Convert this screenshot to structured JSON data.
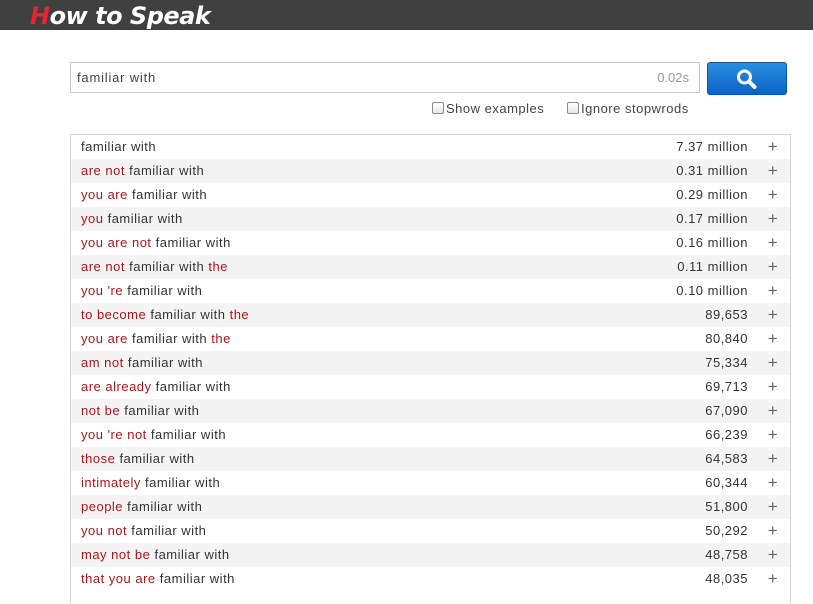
{
  "header": {
    "logo_first": "H",
    "logo_rest": "ow to Speak"
  },
  "search": {
    "value": "familiar with",
    "time": "0.02s",
    "button_icon": "search-icon"
  },
  "options": {
    "show_examples": "Show examples",
    "ignore_stopwords": "Ignore stopwrods"
  },
  "colors": {
    "topbar": "#404040",
    "logo_accent": "#e8242c",
    "extra_word": "#a8161c",
    "button": "#1a78d6"
  },
  "results": [
    {
      "words": [
        {
          "t": "familiar with",
          "q": true
        }
      ],
      "count": "7.37 million"
    },
    {
      "words": [
        {
          "t": "are not",
          "q": false
        },
        {
          "t": "familiar with",
          "q": true
        }
      ],
      "count": "0.31 million"
    },
    {
      "words": [
        {
          "t": "you are",
          "q": false
        },
        {
          "t": "familiar with",
          "q": true
        }
      ],
      "count": "0.29 million"
    },
    {
      "words": [
        {
          "t": "you",
          "q": false
        },
        {
          "t": "familiar with",
          "q": true
        }
      ],
      "count": "0.17 million"
    },
    {
      "words": [
        {
          "t": "you are not",
          "q": false
        },
        {
          "t": "familiar with",
          "q": true
        }
      ],
      "count": "0.16 million"
    },
    {
      "words": [
        {
          "t": "are not",
          "q": false
        },
        {
          "t": "familiar with",
          "q": true
        },
        {
          "t": "the",
          "q": false
        }
      ],
      "count": "0.11 million"
    },
    {
      "words": [
        {
          "t": "you 're",
          "q": false
        },
        {
          "t": "familiar with",
          "q": true
        }
      ],
      "count": "0.10 million"
    },
    {
      "words": [
        {
          "t": "to become",
          "q": false
        },
        {
          "t": "familiar with",
          "q": true
        },
        {
          "t": "the",
          "q": false
        }
      ],
      "count": "89,653"
    },
    {
      "words": [
        {
          "t": "you are",
          "q": false
        },
        {
          "t": "familiar with",
          "q": true
        },
        {
          "t": "the",
          "q": false
        }
      ],
      "count": "80,840"
    },
    {
      "words": [
        {
          "t": "am not",
          "q": false
        },
        {
          "t": "familiar with",
          "q": true
        }
      ],
      "count": "75,334"
    },
    {
      "words": [
        {
          "t": "are already",
          "q": false
        },
        {
          "t": "familiar with",
          "q": true
        }
      ],
      "count": "69,713"
    },
    {
      "words": [
        {
          "t": "not be",
          "q": false
        },
        {
          "t": "familiar with",
          "q": true
        }
      ],
      "count": "67,090"
    },
    {
      "words": [
        {
          "t": "you 're not",
          "q": false
        },
        {
          "t": "familiar with",
          "q": true
        }
      ],
      "count": "66,239"
    },
    {
      "words": [
        {
          "t": "those",
          "q": false
        },
        {
          "t": "familiar with",
          "q": true
        }
      ],
      "count": "64,583"
    },
    {
      "words": [
        {
          "t": "intimately",
          "q": false
        },
        {
          "t": "familiar with",
          "q": true
        }
      ],
      "count": "60,344"
    },
    {
      "words": [
        {
          "t": "people",
          "q": false
        },
        {
          "t": "familiar with",
          "q": true
        }
      ],
      "count": "51,800"
    },
    {
      "words": [
        {
          "t": "you not",
          "q": false
        },
        {
          "t": "familiar with",
          "q": true
        }
      ],
      "count": "50,292"
    },
    {
      "words": [
        {
          "t": "may not be",
          "q": false
        },
        {
          "t": "familiar with",
          "q": true
        }
      ],
      "count": "48,758"
    },
    {
      "words": [
        {
          "t": "that you are",
          "q": false
        },
        {
          "t": "familiar with",
          "q": true
        }
      ],
      "count": "48,035"
    }
  ],
  "row_action": "+"
}
